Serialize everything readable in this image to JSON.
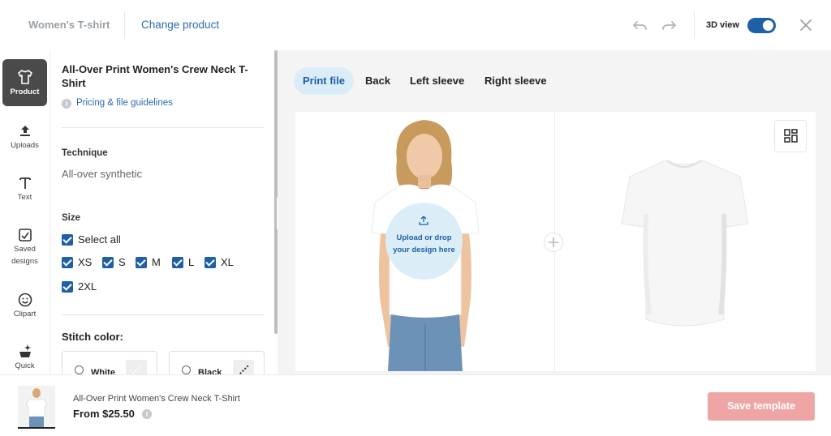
{
  "header": {
    "product_name": "Women's T-shirt",
    "change_product": "Change product",
    "view_3d_label": "3D view",
    "view_3d_enabled": true
  },
  "rail": {
    "items": [
      {
        "label": "Product",
        "icon": "tshirt-icon",
        "active": true
      },
      {
        "label": "Uploads",
        "icon": "upload-icon"
      },
      {
        "label": "Text",
        "icon": "text-icon"
      },
      {
        "label": "Saved designs",
        "icon": "saved-designs-icon"
      },
      {
        "label": "Clipart",
        "icon": "smiley-icon"
      },
      {
        "label": "Quick",
        "icon": "quick-designs-icon"
      }
    ]
  },
  "panel": {
    "title": "All-Over Print Women's Crew Neck T-Shirt",
    "guidelines_link": "Pricing & file guidelines",
    "technique_label": "Technique",
    "technique_value": "All-over synthetic",
    "size_label": "Size",
    "select_all": "Select all",
    "sizes": [
      "XS",
      "S",
      "M",
      "L",
      "XL",
      "2XL"
    ],
    "stitch_label": "Stitch color:",
    "stitch_options": [
      "White",
      "Black"
    ]
  },
  "tabs": [
    "Print file",
    "Back",
    "Left sleeve",
    "Right sleeve"
  ],
  "active_tab": "Print file",
  "upload_prompt": "Upload or drop your design here",
  "footer": {
    "product_name": "All-Over Print Women's Crew Neck T-Shirt",
    "price": "From $25.50",
    "save_button": "Save template"
  },
  "colors": {
    "accent": "#1f5fa8",
    "link": "#2b6cb0",
    "tab_active_bg": "#dbeef8",
    "save_disabled": "#f0a5a5",
    "rail_active": "#4a4a4a"
  }
}
